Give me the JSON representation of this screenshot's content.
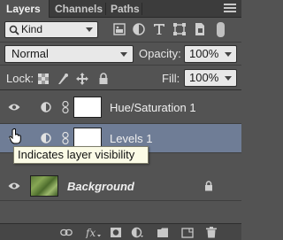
{
  "tabs": [
    {
      "label": "Layers",
      "active": true
    },
    {
      "label": "Channels",
      "active": false
    },
    {
      "label": "Paths",
      "active": false
    }
  ],
  "filter": {
    "kind_label": "Kind",
    "icons": [
      "pixel-filter-icon",
      "adjustment-filter-icon",
      "type-filter-icon",
      "shape-filter-icon",
      "smart-object-filter-icon"
    ]
  },
  "blend": {
    "mode": "Normal",
    "opacity_label": "Opacity:",
    "opacity_value": "100%"
  },
  "lock": {
    "label": "Lock:",
    "fill_label": "Fill:",
    "fill_value": "100%"
  },
  "layers": [
    {
      "name": "Hue/Saturation 1",
      "type": "adjustment",
      "visible": true,
      "selected": false
    },
    {
      "name": "Levels 1",
      "type": "adjustment",
      "visible": true,
      "selected": true
    },
    {
      "name": "Background",
      "type": "image",
      "visible": true,
      "selected": false,
      "locked": true
    }
  ],
  "tooltip": {
    "text": "Indicates layer visibility"
  },
  "colors": {
    "panel_bg": "#535353",
    "selected_row": "#6f7d96",
    "tooltip_bg": "#fbfbe6"
  }
}
